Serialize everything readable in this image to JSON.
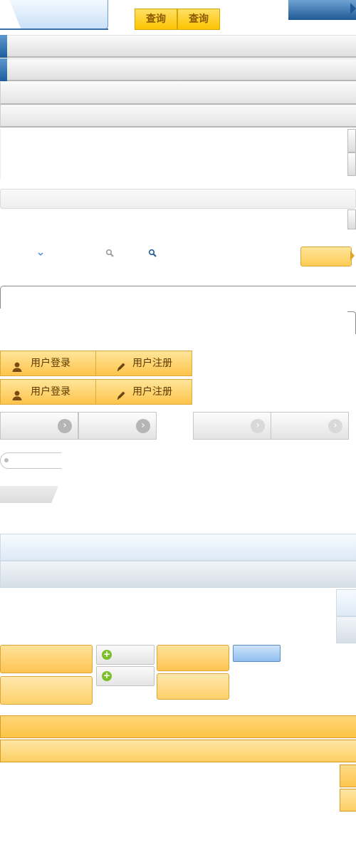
{
  "header": {
    "query_buttons": [
      "查询",
      "查询"
    ]
  },
  "auth": {
    "login_label": "用户登录",
    "register_label": "用户注册"
  },
  "icons": {
    "dropdown": "chevron-down-icon",
    "search_gray": "search-icon",
    "search_blue": "search-icon",
    "arrow": "arrow-right-icon",
    "add": "plus-icon",
    "user": "user-icon",
    "edit": "pencil-icon"
  },
  "colors": {
    "accent_blue": "#1f5a96",
    "button_yellow": "#fdc400",
    "panel_blue": "#dde9f6",
    "add_green": "#7bbf2a"
  }
}
